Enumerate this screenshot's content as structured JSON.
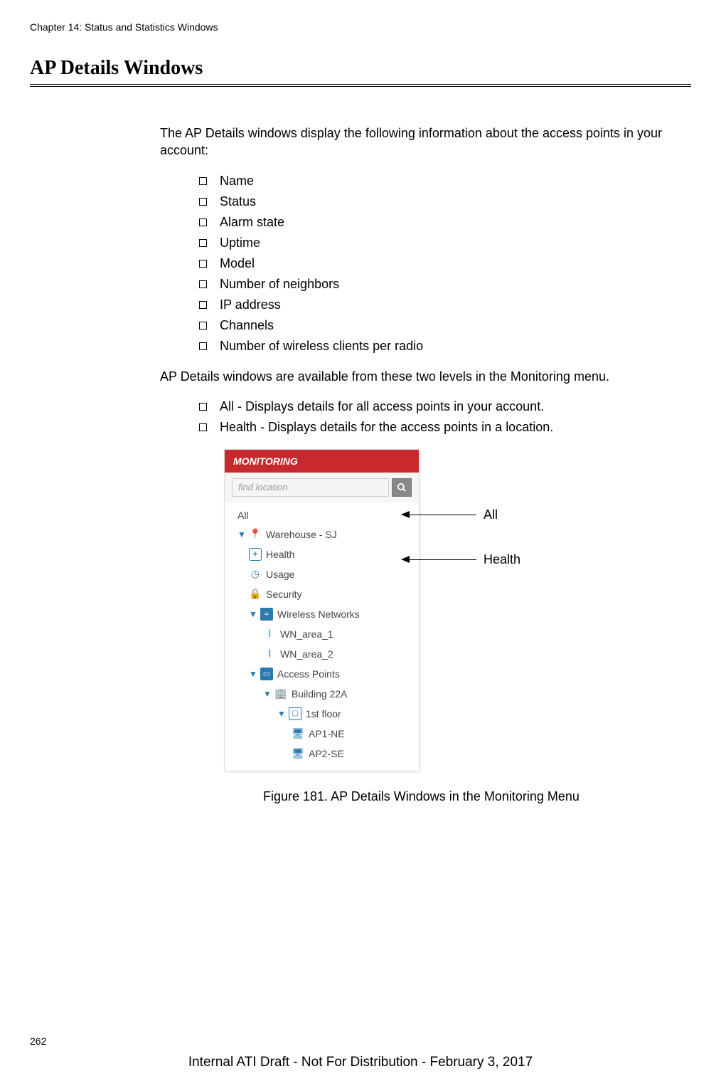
{
  "header": "Chapter 14: Status and Statistics Windows",
  "section_title": "AP Details Windows",
  "intro": "The AP Details windows display the following information about the access points in your account:",
  "bullets1": [
    "Name",
    "Status",
    "Alarm state",
    "Uptime",
    "Model",
    "Number of neighbors",
    "IP address",
    "Channels",
    "Number of wireless clients per radio"
  ],
  "para2": "AP Details windows are available from these two levels in the Monitoring menu.",
  "bullets2": [
    "All - Displays details for all access points in your account.",
    "Health - Displays details for the access points in a location."
  ],
  "monitoring": {
    "title": "MONITORING",
    "search_placeholder": "find location",
    "items": {
      "all": "All",
      "location": "Warehouse - SJ",
      "health": "Health",
      "usage": "Usage",
      "security": "Security",
      "wireless_networks": "Wireless Networks",
      "wn1": "WN_area_1",
      "wn2": "WN_area_2",
      "access_points": "Access Points",
      "building": "Building 22A",
      "floor": "1st floor",
      "ap1": "AP1-NE",
      "ap2": "AP2-SE"
    }
  },
  "annotations": {
    "all": "All",
    "health": "Health"
  },
  "figure_caption": "Figure 181. AP Details Windows in the Monitoring Menu",
  "page_number": "262",
  "footer": "Internal ATI Draft - Not For Distribution - February 3, 2017"
}
